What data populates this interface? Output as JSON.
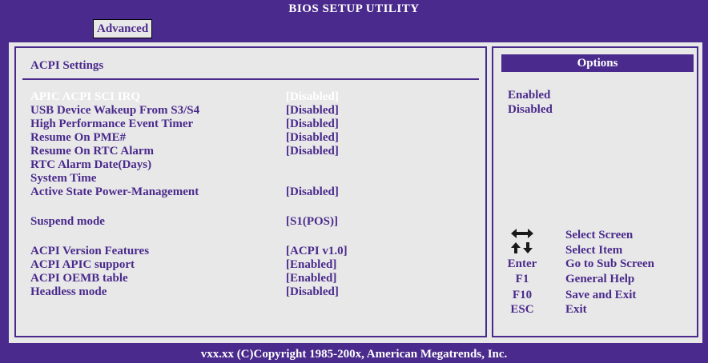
{
  "header": {
    "title": "BIOS SETUP UTILITY",
    "tab": "Advanced"
  },
  "section": {
    "title": "ACPI Settings"
  },
  "settings": [
    {
      "label": "APIC ACPI SCI IRQ",
      "value": "[Disabled]"
    },
    {
      "label": "USB Device Wakeup From S3/S4",
      "value": "[Disabled]"
    },
    {
      "label": "High Performance Event Timer",
      "value": "[Disabled]"
    },
    {
      "label": "Resume On PME#",
      "value": "[Disabled]"
    },
    {
      "label": "Resume On RTC Alarm",
      "value": "[Disabled]"
    },
    {
      "label": "RTC Alarm Date(Days)",
      "value": ""
    },
    {
      "label": "System Time",
      "value": ""
    },
    {
      "label": "Active State Power-Management",
      "value": "[Disabled]"
    },
    {
      "label": "Suspend mode",
      "value": "[S1(POS)]"
    },
    {
      "label": "ACPI Version Features",
      "value": "[ACPI v1.0]"
    },
    {
      "label": "ACPI APIC support",
      "value": "[Enabled]"
    },
    {
      "label": "ACPI OEMB table",
      "value": "[Enabled]"
    },
    {
      "label": "Headless mode",
      "value": "[Disabled]"
    }
  ],
  "options": {
    "header": "Options",
    "items": [
      "Enabled",
      "Disabled"
    ]
  },
  "help": [
    {
      "key": "",
      "icon": "left-right-arrows-icon",
      "desc": "Select Screen"
    },
    {
      "key": "",
      "icon": "up-down-arrows-icon",
      "desc": "Select Item"
    },
    {
      "key": "Enter",
      "desc": "Go to Sub Screen"
    },
    {
      "key": "F1",
      "desc": "General Help"
    },
    {
      "key": "F10",
      "desc": "Save and Exit"
    },
    {
      "key": "ESC",
      "desc": "Exit"
    }
  ],
  "footer": {
    "text": "vxx.xx (C)Copyright 1985-200x, American Megatrends, Inc."
  },
  "colors": {
    "accent": "#4a2a8c",
    "panel": "#e8e8e8",
    "selected_text": "#ffffff"
  }
}
